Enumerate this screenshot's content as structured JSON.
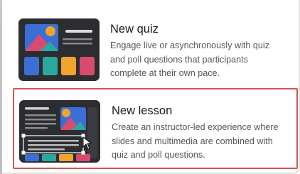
{
  "options": [
    {
      "title": "New quiz",
      "description_lines": [
        "Engage live or asynchronously with quiz",
        "and poll questions that participants",
        "complete at their own pace."
      ],
      "icon": "quiz-thumbnail-icon",
      "selected": false
    },
    {
      "title": "New lesson",
      "description_lines": [
        "Create an instructor-led experience where",
        "slides and multimedia are combined with",
        "quiz and poll questions."
      ],
      "icon": "lesson-thumbnail-icon",
      "selected": true
    }
  ],
  "colors": {
    "thumb_bg": "#2b2d31",
    "accent_blue": "#3b6fd6",
    "accent_teal": "#2aa8a0",
    "accent_orange": "#f2a32b",
    "accent_pink": "#d84b6e",
    "selection_border": "#d9534f"
  }
}
